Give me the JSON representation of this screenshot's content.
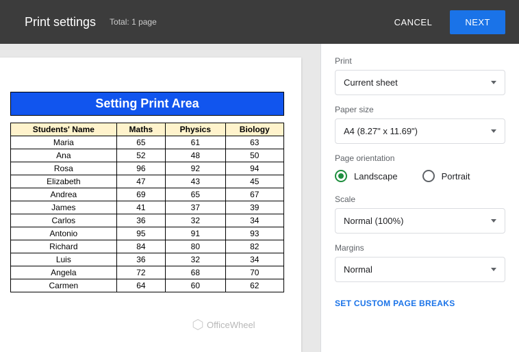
{
  "header": {
    "title": "Print settings",
    "total": "Total: 1 page",
    "cancel": "CANCEL",
    "next": "NEXT"
  },
  "preview": {
    "banner": "Setting Print Area",
    "columns": [
      "Students' Name",
      "Maths",
      "Physics",
      "Biology"
    ],
    "rows": [
      {
        "name": "Maria",
        "maths": "65",
        "physics": "61",
        "biology": "63"
      },
      {
        "name": "Ana",
        "maths": "52",
        "physics": "48",
        "biology": "50"
      },
      {
        "name": "Rosa",
        "maths": "96",
        "physics": "92",
        "biology": "94"
      },
      {
        "name": "Elizabeth",
        "maths": "47",
        "physics": "43",
        "biology": "45"
      },
      {
        "name": "Andrea",
        "maths": "69",
        "physics": "65",
        "biology": "67"
      },
      {
        "name": "James",
        "maths": "41",
        "physics": "37",
        "biology": "39"
      },
      {
        "name": "Carlos",
        "maths": "36",
        "physics": "32",
        "biology": "34"
      },
      {
        "name": "Antonio",
        "maths": "95",
        "physics": "91",
        "biology": "93"
      },
      {
        "name": "Richard",
        "maths": "84",
        "physics": "80",
        "biology": "82"
      },
      {
        "name": "Luis",
        "maths": "36",
        "physics": "32",
        "biology": "34"
      },
      {
        "name": "Angela",
        "maths": "72",
        "physics": "68",
        "biology": "70"
      },
      {
        "name": "Carmen",
        "maths": "64",
        "physics": "60",
        "biology": "62"
      }
    ]
  },
  "sidebar": {
    "print_label": "Print",
    "print_value": "Current sheet",
    "paper_label": "Paper size",
    "paper_value": "A4 (8.27\" x 11.69\")",
    "orientation_label": "Page orientation",
    "landscape": "Landscape",
    "portrait": "Portrait",
    "scale_label": "Scale",
    "scale_value": "Normal (100%)",
    "margins_label": "Margins",
    "margins_value": "Normal",
    "custom_breaks": "SET CUSTOM PAGE BREAKS"
  },
  "watermark": "OfficeWheel"
}
